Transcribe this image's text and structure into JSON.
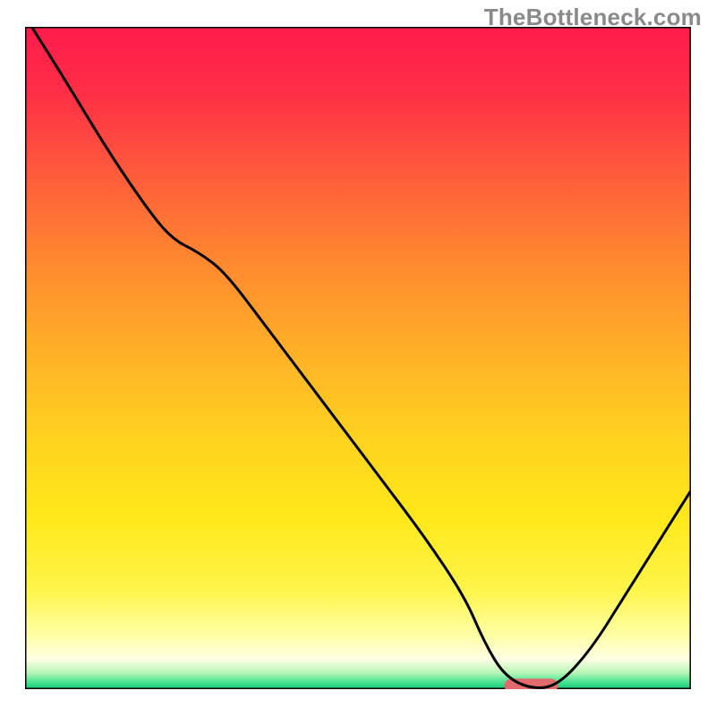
{
  "watermark": "TheBottleneck.com",
  "colors": {
    "curve": "#000000",
    "border": "#000000",
    "pill": "#e26a6d",
    "gradient_stops": [
      {
        "offset": 0.0,
        "color": "#ff1b4b"
      },
      {
        "offset": 0.1,
        "color": "#ff2f46"
      },
      {
        "offset": 0.22,
        "color": "#ff5a3b"
      },
      {
        "offset": 0.36,
        "color": "#ff8a2f"
      },
      {
        "offset": 0.5,
        "color": "#ffb327"
      },
      {
        "offset": 0.62,
        "color": "#ffd21f"
      },
      {
        "offset": 0.74,
        "color": "#ffe81a"
      },
      {
        "offset": 0.85,
        "color": "#fff54a"
      },
      {
        "offset": 0.92,
        "color": "#ffffa8"
      },
      {
        "offset": 0.955,
        "color": "#fdffe2"
      },
      {
        "offset": 0.975,
        "color": "#b8f7b8"
      },
      {
        "offset": 0.99,
        "color": "#41e28e"
      },
      {
        "offset": 1.0,
        "color": "#18c574"
      }
    ]
  },
  "chart_data": {
    "type": "line",
    "title": "",
    "xlabel": "",
    "ylabel": "",
    "xlim": [
      0,
      100
    ],
    "ylim": [
      0,
      100
    ],
    "x": [
      1,
      6,
      12,
      18,
      22,
      26,
      30,
      36,
      42,
      48,
      54,
      60,
      66,
      69,
      72,
      76,
      80,
      85,
      90,
      95,
      100
    ],
    "values": [
      100,
      92,
      82,
      73,
      68,
      66,
      63,
      55,
      47,
      39,
      31,
      23,
      14,
      7,
      2,
      0,
      0.5,
      6,
      14,
      22,
      30
    ],
    "optimal_zone": {
      "x_start": 72,
      "x_end": 80,
      "y": 0.5
    },
    "annotations": []
  }
}
